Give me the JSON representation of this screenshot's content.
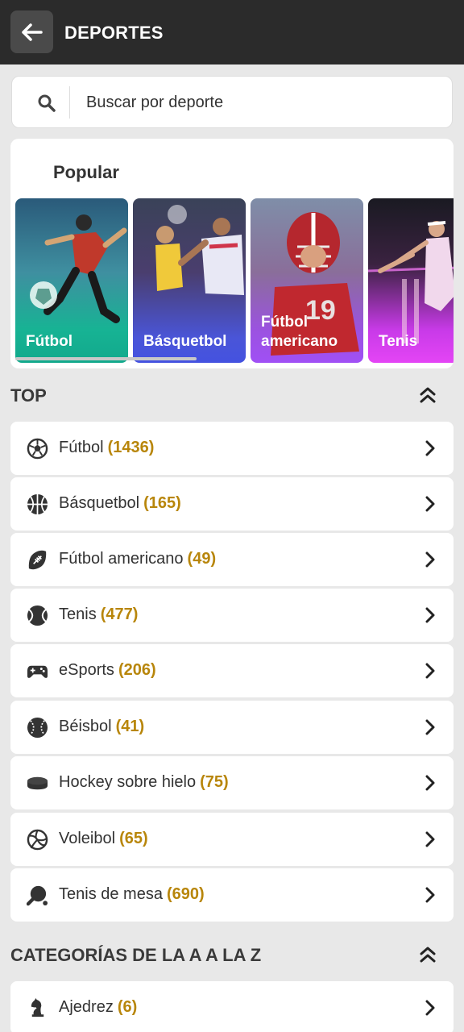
{
  "header": {
    "title": "DEPORTES",
    "back_icon": "arrow-left-icon"
  },
  "search": {
    "placeholder": "Buscar por deporte",
    "icon": "search-icon"
  },
  "popular": {
    "title": "Popular",
    "cards": [
      {
        "label": "Fútbol",
        "accent": "#14b89a"
      },
      {
        "label": "Básquetbol",
        "accent": "#4a5ae8"
      },
      {
        "label": "Fútbol americano",
        "accent": "#a855f7"
      },
      {
        "label": "Tenis",
        "accent": "#e040fb"
      }
    ]
  },
  "top": {
    "title": "TOP",
    "items": [
      {
        "name": "Fútbol",
        "count": "(1436)",
        "icon": "soccer-ball-icon"
      },
      {
        "name": "Básquetbol",
        "count": "(165)",
        "icon": "basketball-icon"
      },
      {
        "name": "Fútbol americano",
        "count": "(49)",
        "icon": "american-football-icon"
      },
      {
        "name": "Tenis",
        "count": "(477)",
        "icon": "tennis-ball-icon"
      },
      {
        "name": "eSports",
        "count": "(206)",
        "icon": "gamepad-icon"
      },
      {
        "name": "Béisbol",
        "count": "(41)",
        "icon": "baseball-icon"
      },
      {
        "name": "Hockey sobre hielo",
        "count": "(75)",
        "icon": "hockey-puck-icon"
      },
      {
        "name": "Voleibol",
        "count": "(65)",
        "icon": "volleyball-icon"
      },
      {
        "name": "Tenis de mesa",
        "count": "(690)",
        "icon": "ping-pong-paddle-icon"
      }
    ]
  },
  "az": {
    "title": "CATEGORÍAS DE LA A A LA Z",
    "items": [
      {
        "name": "Ajedrez",
        "count": "(6)",
        "icon": "chess-knight-icon"
      }
    ]
  },
  "colors": {
    "topbar": "#2b2b2b",
    "count": "#b8860b",
    "background": "#e8e8e8"
  }
}
